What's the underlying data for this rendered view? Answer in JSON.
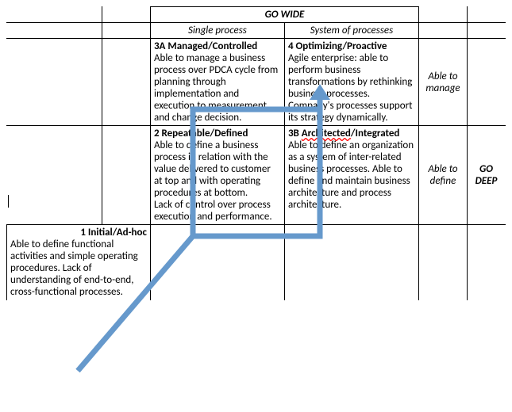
{
  "header_wide": "GO WIDE",
  "header_single": "Single process",
  "header_system": "System of processes",
  "header_deep": "GO DEEP",
  "side_manage": "Able to manage",
  "side_define": "Able to define",
  "cells": {
    "c3a_title": "3A Managed/Controlled",
    "c3a_body": "Able to manage a business process over PDCA cycle from planning through implementation and execution to measurement and change decision.",
    "c4_title": "4 Optimizing/Proactive",
    "c4_body": "Agile enterprise: able to perform business transformations by rethinking business processes. Company's processes support its strategy dynamically.",
    "c2_title": "2 Repeatable/Defined",
    "c2_body": "Able to define a business process in relation with the value delivered to customer at top and with operating procedures at bottom.\nLack of control over process execution and performance.",
    "c3b_prefix": "3B ",
    "c3b_word": "Architected",
    "c3b_suffix": "/Integrated",
    "c3b_body": "Able to define an organization as a system of inter-related business processes. Able to define and maintain business architecture and process architecture.",
    "c1_title": "1 Initial/Ad-hoc",
    "c1_body": "Able to define functional activities and simple operating procedures. Lack of understanding of end-to-end, cross-functional processes."
  }
}
